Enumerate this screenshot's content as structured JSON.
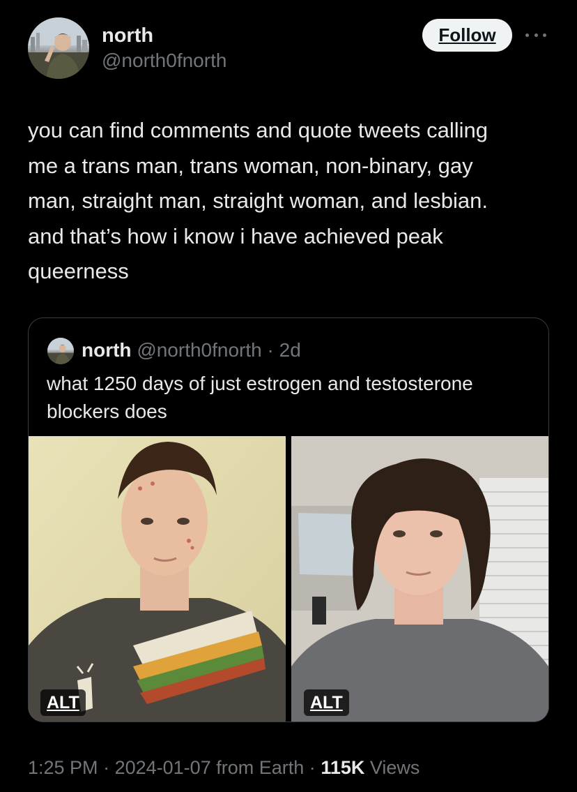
{
  "author": {
    "name": "north",
    "handle": "@north0fnorth",
    "avatar_icon": "profile-photo"
  },
  "actions": {
    "follow_label": "Follow",
    "more_icon": "more-horizontal-icon"
  },
  "tweet": {
    "text": "you can find comments and quote tweets calling\nme a trans man, trans woman, non-binary, gay\nman, straight man, straight woman, and lesbian.\nand that’s how i know i have achieved peak\nqueerness"
  },
  "quote": {
    "name": "north",
    "handle": "@north0fnorth",
    "separator": "·",
    "age": "2d",
    "text": "what 1250 days of just estrogen and testosterone blockers does",
    "media": [
      {
        "alt_label": "ALT"
      },
      {
        "alt_label": "ALT"
      }
    ]
  },
  "footer": {
    "time": "1:25 PM",
    "date": "2024-01-07",
    "source": "from Earth",
    "views_count": "115K",
    "views_label": "Views",
    "separator": "·"
  },
  "colors": {
    "background": "#000000",
    "primary_text": "#e7e9ea",
    "secondary_text": "#71767b",
    "follow_bg": "#eff3f4"
  }
}
